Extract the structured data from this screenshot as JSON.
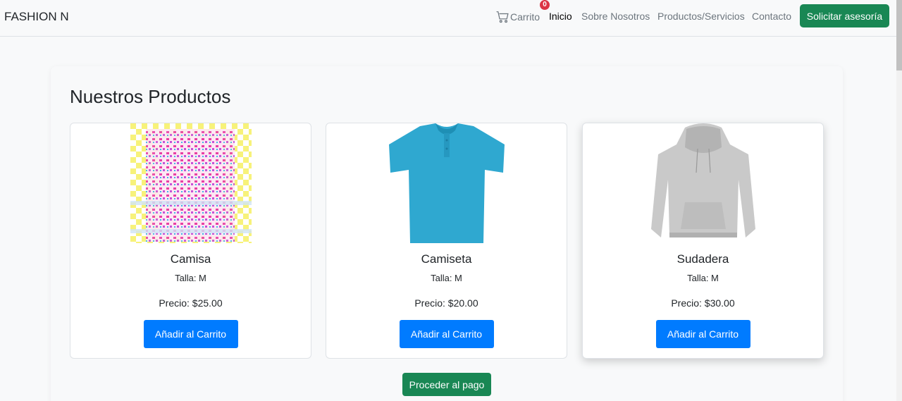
{
  "navbar": {
    "brand": "FASHION N",
    "cart_label": "Carrito",
    "cart_count": "0",
    "links": [
      {
        "label": "Inicio",
        "active": true
      },
      {
        "label": "Sobre Nosotros",
        "active": false
      },
      {
        "label": "Productos/Servicios",
        "active": false
      },
      {
        "label": "Contacto",
        "active": false
      }
    ],
    "cta_label": "Solicitar asesoría"
  },
  "main": {
    "title": "Nuestros Productos",
    "products": [
      {
        "name": "Camisa",
        "size": "Talla: M",
        "price": "Precio: $25.00",
        "button": "Añadir al Carrito",
        "image": "patterned-shirt-image"
      },
      {
        "name": "Camiseta",
        "size": "Talla: M",
        "price": "Precio: $20.00",
        "button": "Añadir al Carrito",
        "image": "blue-polo-shirt-image"
      },
      {
        "name": "Sudadera",
        "size": "Talla: M",
        "price": "Precio: $30.00",
        "button": "Añadir al Carrito",
        "image": "gray-hoodie-image"
      }
    ],
    "checkout_label": "Proceder al pago"
  },
  "colors": {
    "primary_button": "#007bff",
    "success_button": "#198754",
    "badge": "#dc3545"
  }
}
